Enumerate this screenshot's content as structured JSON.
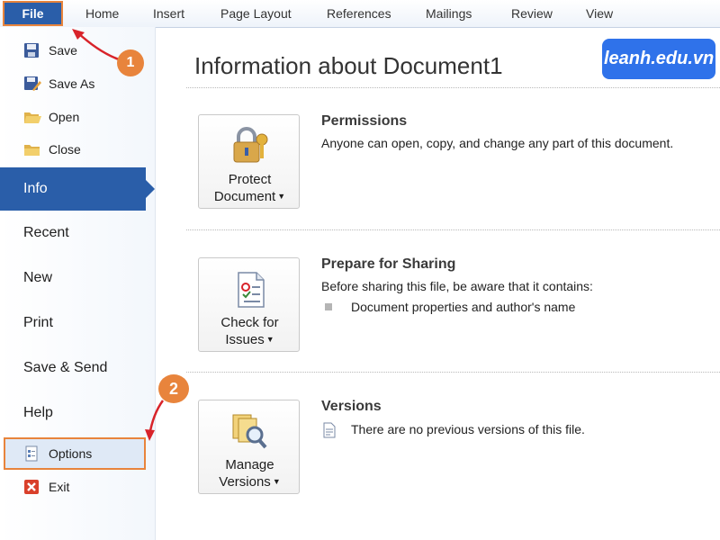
{
  "ribbon": {
    "file_tab": "File",
    "tabs": [
      "Home",
      "Insert",
      "Page Layout",
      "References",
      "Mailings",
      "Review",
      "View"
    ]
  },
  "sidebar": {
    "commands_top": [
      "Save",
      "Save As",
      "Open",
      "Close"
    ],
    "nav": [
      "Info",
      "Recent",
      "New",
      "Print",
      "Save & Send",
      "Help"
    ],
    "commands_bottom": [
      "Options",
      "Exit"
    ]
  },
  "annotations": {
    "step1": "1",
    "step2": "2"
  },
  "watermark": "leanh.edu.vn",
  "main": {
    "title": "Information about Document1",
    "permissions": {
      "button_line1": "Protect",
      "button_line2": "Document",
      "title": "Permissions",
      "text": "Anyone can open, copy, and change any part of this document."
    },
    "sharing": {
      "button_line1": "Check for",
      "button_line2": "Issues",
      "title": "Prepare for Sharing",
      "text": "Before sharing this file, be aware that it contains:",
      "bullet": "Document properties and author's name"
    },
    "versions": {
      "button_line1": "Manage",
      "button_line2": "Versions",
      "title": "Versions",
      "text": "There are no previous versions of this file."
    }
  },
  "colors": {
    "accent": "#2a5ea9",
    "callout": "#e8843c",
    "arrow": "#d8232a",
    "watermark_bg": "#2f72ea"
  }
}
